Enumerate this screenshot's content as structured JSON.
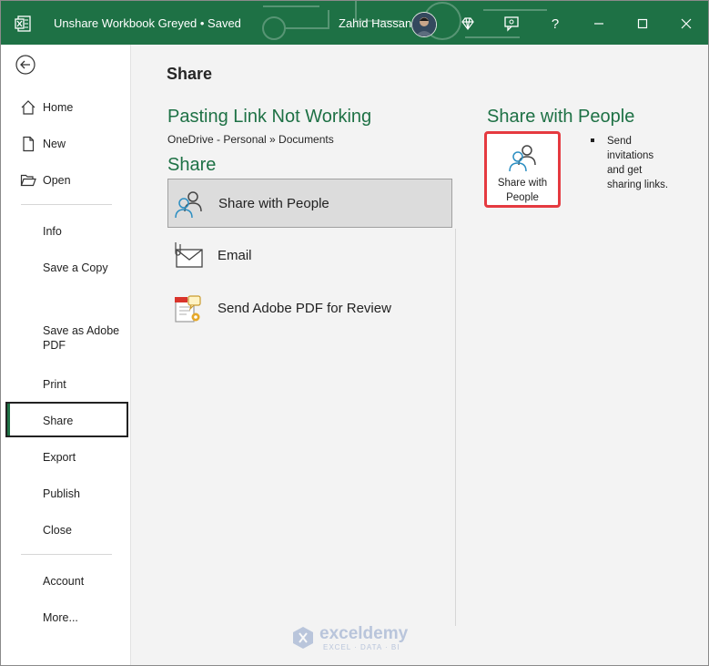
{
  "titlebar": {
    "doc_title": "Unshare Workbook Greyed  •  Saved",
    "user_name": "Zahid Hassan",
    "help_label": "?",
    "accent": "#1e7145"
  },
  "sidebar": {
    "items": [
      {
        "label": "Home",
        "icon": "home-icon"
      },
      {
        "label": "New",
        "icon": "new-document-icon"
      },
      {
        "label": "Open",
        "icon": "folder-open-icon"
      },
      {
        "label": "Info"
      },
      {
        "label": "Save a Copy"
      },
      {
        "label": "Save as Adobe PDF"
      },
      {
        "label": "Print"
      },
      {
        "label": "Share",
        "active": true
      },
      {
        "label": "Export"
      },
      {
        "label": "Publish"
      },
      {
        "label": "Close"
      },
      {
        "label": "Account"
      },
      {
        "label": "More..."
      }
    ]
  },
  "main": {
    "page_title": "Share",
    "doc_name": "Pasting Link Not Working",
    "location": "OneDrive - Personal » Documents",
    "share_heading": "Share",
    "options": [
      {
        "label": "Share with People",
        "icon": "share-people-icon",
        "selected": true
      },
      {
        "label": "Email",
        "icon": "email-icon"
      },
      {
        "label": "Send Adobe PDF for Review",
        "icon": "adobe-pdf-review-icon"
      }
    ]
  },
  "detail": {
    "heading": "Share with People",
    "button_label": "Share with People",
    "description": "Send invitations and get sharing links."
  },
  "watermark": {
    "name": "exceldemy",
    "tagline": "EXCEL · DATA · BI"
  }
}
